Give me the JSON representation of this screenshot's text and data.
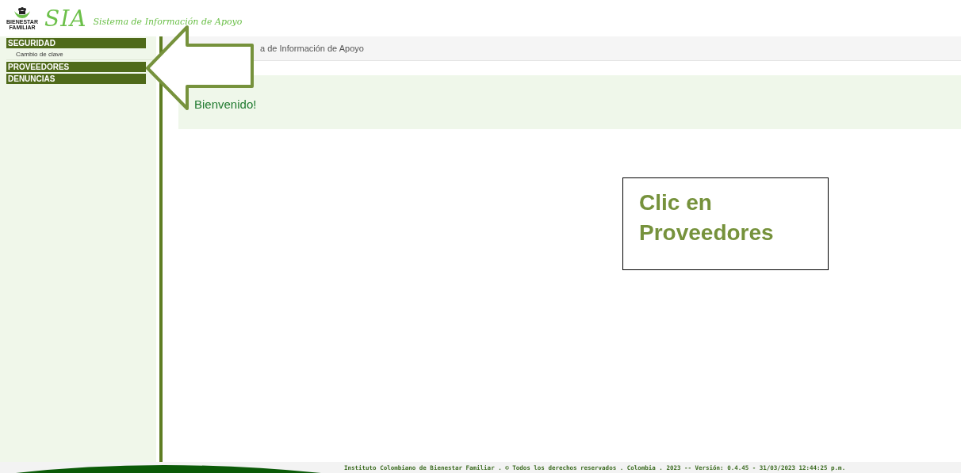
{
  "header": {
    "logo_caption": [
      "BIENESTAR",
      "FAMILIAR"
    ],
    "brand": "SIA",
    "subtitle": "Sistema de Información de Apoyo"
  },
  "sidebar": {
    "sections": [
      {
        "label": "SEGURIDAD",
        "items": [
          "Cambio de clave"
        ]
      },
      {
        "label": "PROVEEDORES"
      },
      {
        "label": "DENUNCIAS"
      }
    ]
  },
  "breadcrumb": "a de Información de Apoyo",
  "welcome": "Bienvenido!",
  "callout": {
    "text": "Clic en Proveedores"
  },
  "footer": "Instituto Colombiano de Bienestar Familiar . © Todos los derechos reservados . Colombia . 2023 -- Versión: 0.4.45 - 31/03/2023 12:44:25 p.m."
}
